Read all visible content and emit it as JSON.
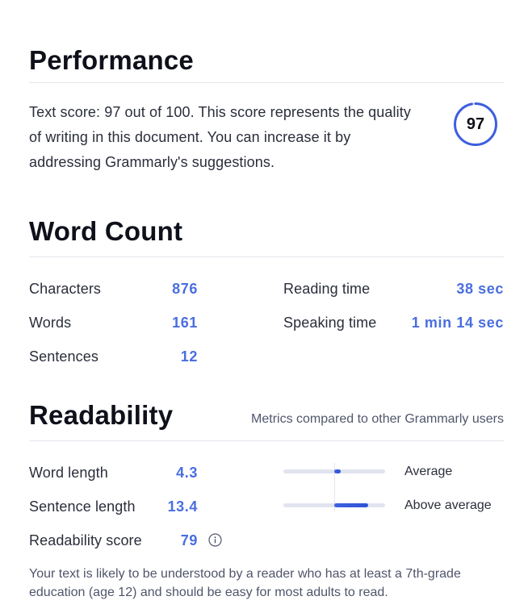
{
  "performance": {
    "title": "Performance",
    "description": "Text score: 97 out of 100. This score represents the quality of writing in this document. You can increase it by addressing Grammarly's suggestions.",
    "score": "97",
    "score_fraction": 0.97,
    "ring_color": "#3d5fe0"
  },
  "word_count": {
    "title": "Word Count",
    "characters": {
      "label": "Characters",
      "value": "876"
    },
    "words": {
      "label": "Words",
      "value": "161"
    },
    "sentences": {
      "label": "Sentences",
      "value": "12"
    },
    "reading_time": {
      "label": "Reading time",
      "value": "38 sec"
    },
    "speaking_time": {
      "label": "Speaking time",
      "value": "1 min 14 sec"
    }
  },
  "readability": {
    "title": "Readability",
    "subtitle": "Metrics compared to other Grammarly users",
    "word_length": {
      "label": "Word length",
      "value": "4.3",
      "rating": "Average",
      "bar_from": 0.5,
      "bar_to": 0.56
    },
    "sentence_length": {
      "label": "Sentence length",
      "value": "13.4",
      "rating": "Above average",
      "bar_from": 0.5,
      "bar_to": 0.83
    },
    "readability_score": {
      "label": "Readability score",
      "value": "79",
      "info_icon": "info-icon"
    },
    "footnote": "Your text is likely to be understood by a reader who has at least a 7th-grade education (age 12) and should be easy for most adults to read."
  },
  "colors": {
    "accent": "#4a6ee0",
    "bar_fill": "#3e62e0",
    "bar_track": "#e1e4ef"
  }
}
